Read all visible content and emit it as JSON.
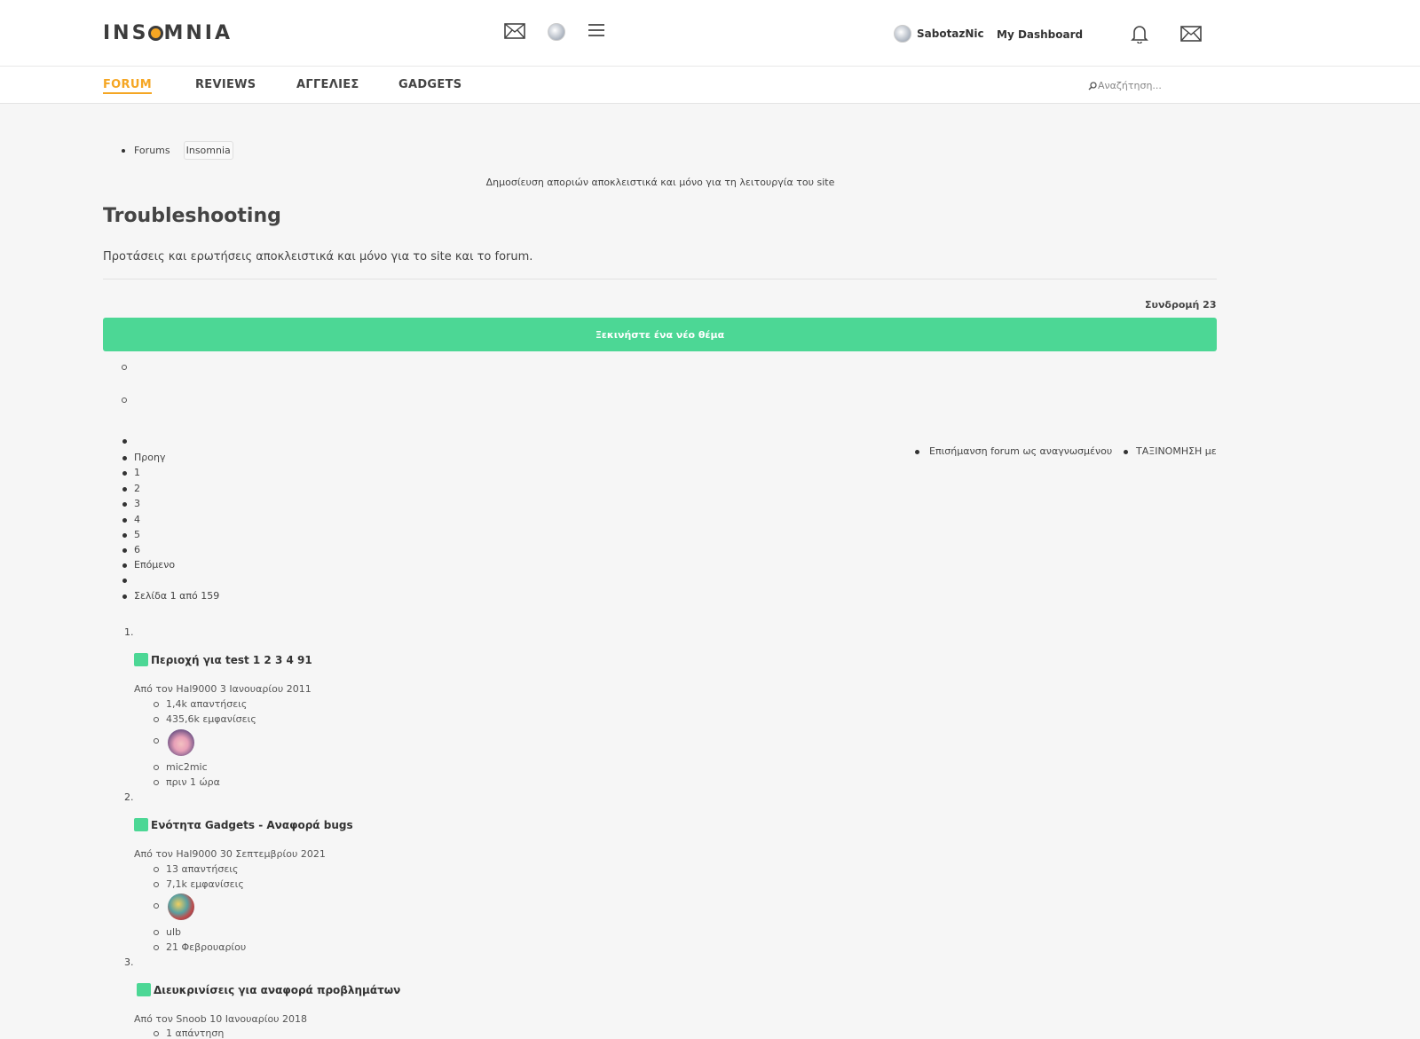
{
  "header": {
    "logo": "INSOMNIA",
    "username": "SabotazNic",
    "dashboard_label": "My Dashboard",
    "icons": [
      "mail-icon",
      "avatar-icon",
      "menu-icon",
      "bell-icon",
      "mail-icon"
    ]
  },
  "nav": {
    "items": [
      "FORUM",
      "REVIEWS",
      "ΑΓΓΕΛΙΕΣ",
      "GADGETS"
    ],
    "search_placeholder": "Αναζήτηση..."
  },
  "breadcrumbs": [
    "Forums",
    "Insomnia"
  ],
  "forum_description": "Δημοσίευση αποριών αποκλειστικά και μόνο για τη λειτουργία του site",
  "page": {
    "title": "Troubleshooting",
    "subtitle": "Προτάσεις και ερωτήσεις αποκλειστικά και μόνο για το site και το forum.",
    "follow": "Συνδρομή 23",
    "new_topic_button": "Ξεκινήστε ένα νέο θέμα"
  },
  "pagination": {
    "prev": "Προηγ",
    "pages": [
      "1",
      "2",
      "3",
      "4",
      "5",
      "6"
    ],
    "next": "Επόμενο",
    "page_info": "Σελίδα 1 από 159"
  },
  "actions": {
    "mark_read": "Επισήμανση forum ως αναγνωσμένου",
    "sort": "ΤΑΞΙΝΟΜΗΣΗ με"
  },
  "topics": [
    {
      "num": "1.",
      "title": "Περιοχή για test 1 2 3 4 91",
      "meta": "Από τον Hal9000 3 Ιανουαρίου 2011",
      "replies": "1,4k απαντήσεις",
      "views": "435,6k εμφανίσεις",
      "last_user": "mic2mic",
      "last_time": "πριν 1 ώρα"
    },
    {
      "num": "2.",
      "title": "Ενότητα Gadgets - Αναφορά bugs",
      "meta": "Από τον Hal9000 30 Σεπτεμβρίου 2021",
      "replies": "13 απαντήσεις",
      "views": "7,1k εμφανίσεις",
      "last_user": "ulb",
      "last_time": "21 Φεβρουαρίου"
    },
    {
      "num": "3.",
      "title": "Διευκρινίσεις για αναφορά προβλημάτων",
      "meta": "Από τον Snoob 10 Ιανουαρίου 2018",
      "replies": "1 απάντηση"
    }
  ],
  "colors": {
    "accent": "#f5a623",
    "button": "#4cd795",
    "background": "#f6f6f6"
  }
}
